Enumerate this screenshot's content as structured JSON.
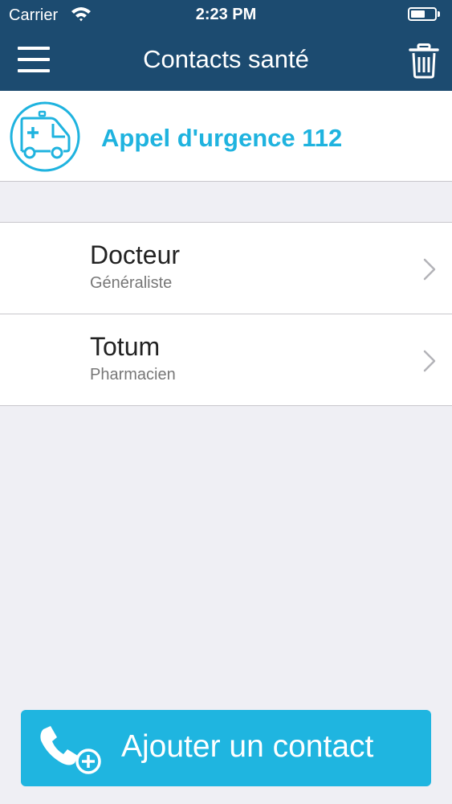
{
  "status_bar": {
    "carrier": "Carrier",
    "time": "2:23 PM",
    "battery_level": 0.6
  },
  "nav": {
    "title": "Contacts santé",
    "menu_icon": "hamburger-menu-icon",
    "trash_icon": "trash-icon"
  },
  "emergency": {
    "label": "Appel d'urgence 112",
    "icon": "ambulance-icon"
  },
  "contacts": [
    {
      "name": "Docteur",
      "role": "Généraliste"
    },
    {
      "name": "Totum",
      "role": "Pharmacien"
    }
  ],
  "add_contact": {
    "label": "Ajouter un contact",
    "icon": "add-phone-contact-icon"
  },
  "colors": {
    "header": "#1c4b70",
    "accent": "#1fb3df",
    "background": "#efeff4"
  }
}
